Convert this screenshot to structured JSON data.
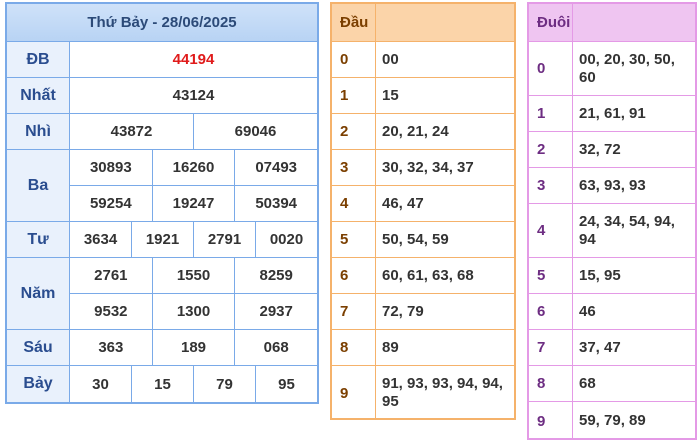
{
  "header": {
    "title": "Thứ Bảy - 28/06/2025"
  },
  "prizes": [
    {
      "label": "ĐB",
      "rows": [
        [
          "44194"
        ]
      ],
      "highlight": true
    },
    {
      "label": "Nhất",
      "rows": [
        [
          "43124"
        ]
      ]
    },
    {
      "label": "Nhì",
      "rows": [
        [
          "43872",
          "69046"
        ]
      ]
    },
    {
      "label": "Ba",
      "rows": [
        [
          "30893",
          "16260",
          "07493"
        ],
        [
          "59254",
          "19247",
          "50394"
        ]
      ]
    },
    {
      "label": "Tư",
      "rows": [
        [
          "3634",
          "1921",
          "2791",
          "0020"
        ]
      ]
    },
    {
      "label": "Năm",
      "rows": [
        [
          "2761",
          "1550",
          "8259"
        ],
        [
          "9532",
          "1300",
          "2937"
        ]
      ]
    },
    {
      "label": "Sáu",
      "rows": [
        [
          "363",
          "189",
          "068"
        ]
      ]
    },
    {
      "label": "Bảy",
      "rows": [
        [
          "30",
          "15",
          "79",
          "95"
        ]
      ]
    }
  ],
  "dau": {
    "header": "Đầu",
    "rows": [
      {
        "key": "0",
        "value": "00"
      },
      {
        "key": "1",
        "value": "15"
      },
      {
        "key": "2",
        "value": "20, 21, 24"
      },
      {
        "key": "3",
        "value": "30, 32, 34, 37"
      },
      {
        "key": "4",
        "value": "46, 47"
      },
      {
        "key": "5",
        "value": "50, 54, 59"
      },
      {
        "key": "6",
        "value": "60, 61, 63, 68"
      },
      {
        "key": "7",
        "value": "72, 79"
      },
      {
        "key": "8",
        "value": "89"
      },
      {
        "key": "9",
        "value": "91, 93, 93, 94, 94, 95"
      }
    ]
  },
  "duoi": {
    "header": "Đuôi",
    "rows": [
      {
        "key": "0",
        "value": "00, 20, 30, 50, 60"
      },
      {
        "key": "1",
        "value": "21, 61, 91"
      },
      {
        "key": "2",
        "value": "32, 72"
      },
      {
        "key": "3",
        "value": "63, 93, 93"
      },
      {
        "key": "4",
        "value": "24, 34, 54, 94, 94"
      },
      {
        "key": "5",
        "value": "15, 95"
      },
      {
        "key": "6",
        "value": "46"
      },
      {
        "key": "7",
        "value": "37, 47"
      },
      {
        "key": "8",
        "value": "68"
      },
      {
        "key": "9",
        "value": "59, 79, 89"
      }
    ]
  },
  "colors": {
    "special_prize": "#e01b1b",
    "results_border": "#7aaae8",
    "dau_border": "#f5b26b",
    "duoi_border": "#e49ae6"
  }
}
